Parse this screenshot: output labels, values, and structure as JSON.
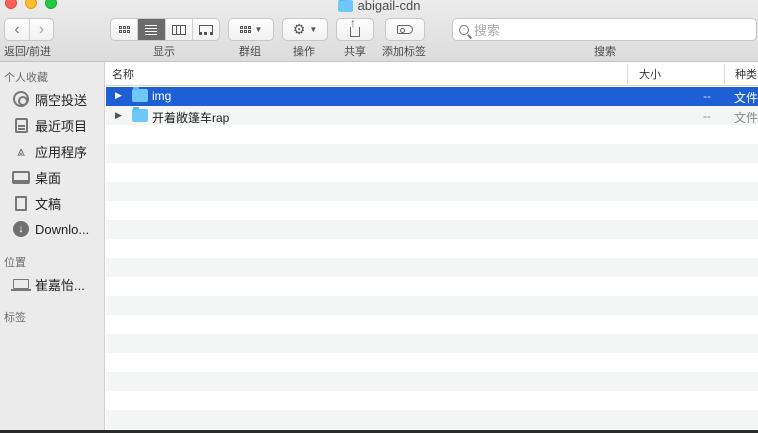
{
  "window": {
    "title": "abigail-cdn"
  },
  "toolbar": {
    "nav_back": "‹",
    "nav_forward": "›",
    "labels": {
      "nav": "返回/前进",
      "view": "显示",
      "group": "群组",
      "action": "操作",
      "share": "共享",
      "tags": "添加标签",
      "search": "搜索"
    },
    "search_placeholder": "搜索",
    "active_view": "list"
  },
  "sidebar": {
    "favorites_header": "个人收藏",
    "favorites": [
      {
        "label": "隔空投送",
        "icon": "airdrop-icon"
      },
      {
        "label": "最近项目",
        "icon": "recents-icon"
      },
      {
        "label": "应用程序",
        "icon": "applications-icon"
      },
      {
        "label": "桌面",
        "icon": "desktop-icon"
      },
      {
        "label": "文稿",
        "icon": "documents-icon"
      },
      {
        "label": "Downlo...",
        "icon": "downloads-icon"
      }
    ],
    "locations_header": "位置",
    "locations": [
      {
        "label": "崔嘉怡...",
        "icon": "laptop-icon"
      }
    ],
    "tags_header": "标签"
  },
  "list": {
    "columns": {
      "name": "名称",
      "size": "大小",
      "kind": "种类"
    },
    "rows": [
      {
        "name": "img",
        "size": "--",
        "kind": "文件",
        "selected": true
      },
      {
        "name": "开着敞篷车rap",
        "size": "--",
        "kind": "文件",
        "selected": false
      }
    ]
  },
  "colors": {
    "selection": "#1f5fd6",
    "folder": "#6ec8f5",
    "sidebar_bg": "#ebebeb",
    "stripe": "#f4f5f5"
  }
}
